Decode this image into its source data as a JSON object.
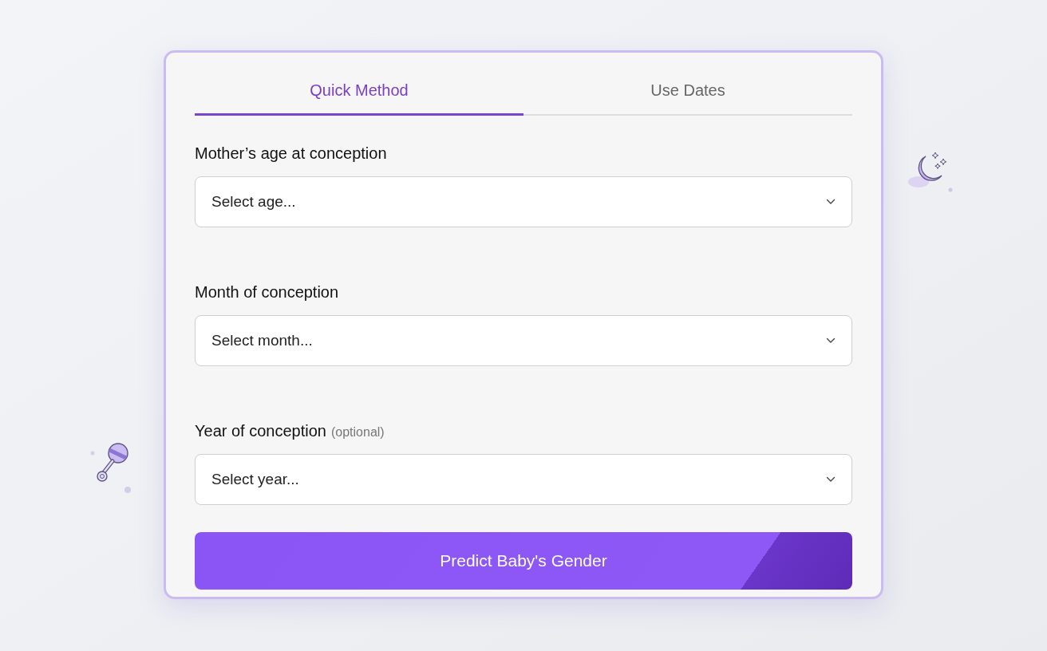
{
  "tabs": [
    {
      "label": "Quick Method",
      "selected": true
    },
    {
      "label": "Use Dates",
      "selected": false
    }
  ],
  "fields": [
    {
      "label": "Mother’s age at conception",
      "placeholder": "Select age..."
    },
    {
      "label": "Month of conception",
      "placeholder": "Select month..."
    },
    {
      "label": "Year of conception",
      "note": "(optional)",
      "placeholder": "Select year..."
    }
  ],
  "submit_button": "Predict Baby's Gender"
}
